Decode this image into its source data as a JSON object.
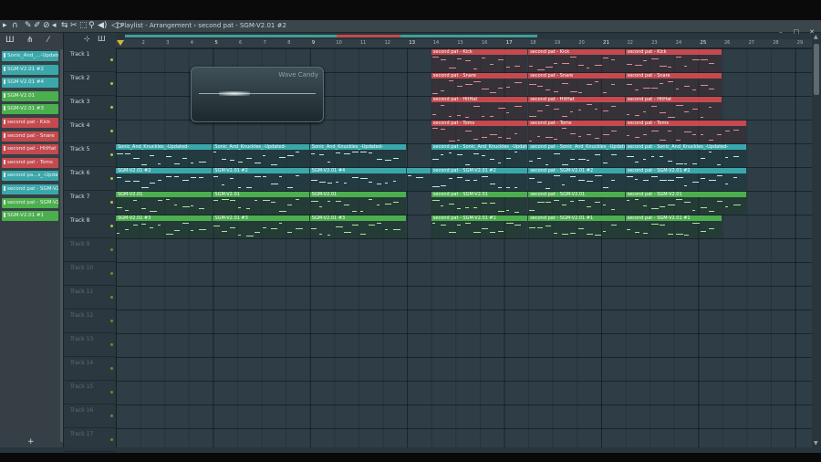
{
  "window": {
    "title": "Playlist - Arrangement › second pat - SGM-V2.01 #2",
    "buttons": [
      "–",
      "□",
      "✕"
    ]
  },
  "toolbar_icons": [
    "arrow-icon",
    "magnet-icon",
    "pencil-icon",
    "paint-icon",
    "delete-icon",
    "mute-icon",
    "slip-icon",
    "slice-icon",
    "select-icon",
    "zoom-icon",
    "speaker-icon"
  ],
  "sidebar": {
    "patterns": [
      {
        "label": "Sonic_And_...-Updated",
        "color": "#3aa8ab"
      },
      {
        "label": "SGM-V2.01 #2",
        "color": "#3aa8ab"
      },
      {
        "label": "SGM-V2.01 #4",
        "color": "#3aa8ab"
      },
      {
        "label": "SGM-V2.01",
        "color": "#4caf4e"
      },
      {
        "label": "SGM-V2.01 #3",
        "color": "#4caf4e"
      },
      {
        "label": "second pat - Kick",
        "color": "#c44a4f"
      },
      {
        "label": "second pat - Snare",
        "color": "#c44a4f"
      },
      {
        "label": "second pat - HitHat",
        "color": "#c44a4f"
      },
      {
        "label": "second pat - Toms",
        "color": "#c44a4f"
      },
      {
        "label": "second pa...s_-Updated",
        "color": "#3aa8ab"
      },
      {
        "label": "second pat - SGM-V2.01 #2",
        "color": "#3aa8ab"
      },
      {
        "label": "second pat - SGM-V2.01 #1",
        "color": "#4caf4e"
      },
      {
        "label": "SGM-V2.01 #1",
        "color": "#4caf4e"
      }
    ],
    "add_label": "+"
  },
  "tracks": [
    {
      "label": "Track 1",
      "dim": false
    },
    {
      "label": "Track 2",
      "dim": false
    },
    {
      "label": "Track 3",
      "dim": false
    },
    {
      "label": "Track 4",
      "dim": false
    },
    {
      "label": "Track 5",
      "dim": false
    },
    {
      "label": "Track 6",
      "dim": false
    },
    {
      "label": "Track 7",
      "dim": false
    },
    {
      "label": "Track 8",
      "dim": false
    },
    {
      "label": "Track 9",
      "dim": true
    },
    {
      "label": "Track 10",
      "dim": true
    },
    {
      "label": "Track 11",
      "dim": true
    },
    {
      "label": "Track 12",
      "dim": true
    },
    {
      "label": "Track 13",
      "dim": true
    },
    {
      "label": "Track 14",
      "dim": true
    },
    {
      "label": "Track 15",
      "dim": true
    },
    {
      "label": "Track 16",
      "dim": true
    },
    {
      "label": "Track 17",
      "dim": true
    }
  ],
  "ruler": {
    "bars": [
      2,
      3,
      4,
      5,
      6,
      7,
      8,
      9,
      10,
      11,
      12,
      13,
      14,
      15,
      16,
      17,
      18,
      19,
      20,
      21,
      22,
      23,
      24,
      25,
      26,
      27,
      28,
      29
    ],
    "emphasized": [
      5,
      9,
      13,
      17,
      21,
      25
    ]
  },
  "plugin": {
    "name": "Wave Candy"
  },
  "clips": [
    {
      "track": 1,
      "start": 14,
      "len": 4,
      "name": "second pat - Kick",
      "color": "red"
    },
    {
      "track": 1,
      "start": 18,
      "len": 4,
      "name": "second pat - Kick",
      "color": "red"
    },
    {
      "track": 1,
      "start": 22,
      "len": 4,
      "name": "second pat - Kick",
      "color": "red"
    },
    {
      "track": 2,
      "start": 14,
      "len": 4,
      "name": "second pat - Snare",
      "color": "red"
    },
    {
      "track": 2,
      "start": 18,
      "len": 4,
      "name": "second pat - Snare",
      "color": "red"
    },
    {
      "track": 2,
      "start": 22,
      "len": 4,
      "name": "second pat - Snare",
      "color": "red"
    },
    {
      "track": 3,
      "start": 14,
      "len": 4,
      "name": "second pat - HitHat",
      "color": "red"
    },
    {
      "track": 3,
      "start": 18,
      "len": 4,
      "name": "second pat - HitHat",
      "color": "red"
    },
    {
      "track": 3,
      "start": 22,
      "len": 4,
      "name": "second pat - HitHat",
      "color": "red"
    },
    {
      "track": 4,
      "start": 14,
      "len": 4,
      "name": "second pat - Toms",
      "color": "red"
    },
    {
      "track": 4,
      "start": 18,
      "len": 4,
      "name": "second pat - Toms",
      "color": "red"
    },
    {
      "track": 4,
      "start": 22,
      "len": 5,
      "name": "second pat - Toms",
      "color": "red"
    },
    {
      "track": 5,
      "start": 1,
      "len": 4,
      "name": "Sonic_And_Knuckles_-Updated-",
      "color": "teal"
    },
    {
      "track": 5,
      "start": 5,
      "len": 4,
      "name": "Sonic_And_Knuckles_-Updated-",
      "color": "teal"
    },
    {
      "track": 5,
      "start": 9,
      "len": 4,
      "name": "Sonic_And_Knuckles_-Updated-",
      "color": "teal"
    },
    {
      "track": 5,
      "start": 14,
      "len": 4,
      "name": "second pat - Sonic_And_Knuckles_-Updated-",
      "color": "teal"
    },
    {
      "track": 5,
      "start": 18,
      "len": 4,
      "name": "second pat - Sonic_And_Knuckles_-Updated-",
      "color": "teal"
    },
    {
      "track": 5,
      "start": 22,
      "len": 5,
      "name": "second pat - Sonic_And_Knuckles_-Updated-",
      "color": "teal"
    },
    {
      "track": 6,
      "start": 1,
      "len": 4,
      "name": "SGM-V2.01 #2",
      "color": "teal"
    },
    {
      "track": 6,
      "start": 5,
      "len": 4,
      "name": "SGM-V2.01 #2",
      "color": "teal"
    },
    {
      "track": 6,
      "start": 9,
      "len": 4,
      "name": "SGM-V2.01 #4",
      "color": "teal"
    },
    {
      "track": 6,
      "start": 13,
      "len": 1,
      "name": "",
      "color": "teal"
    },
    {
      "track": 6,
      "start": 14,
      "len": 4,
      "name": "second pat - SGM-V2.01 #2",
      "color": "teal"
    },
    {
      "track": 6,
      "start": 18,
      "len": 4,
      "name": "second pat - SGM-V2.01 #2",
      "color": "teal"
    },
    {
      "track": 6,
      "start": 22,
      "len": 5,
      "name": "second pat - SGM-V2.01 #2",
      "color": "teal"
    },
    {
      "track": 7,
      "start": 1,
      "len": 4,
      "name": "SGM-V2.01",
      "color": "green"
    },
    {
      "track": 7,
      "start": 5,
      "len": 4,
      "name": "SGM-V2.01",
      "color": "green"
    },
    {
      "track": 7,
      "start": 9,
      "len": 4,
      "name": "SGM-V2.01",
      "color": "green"
    },
    {
      "track": 7,
      "start": 14,
      "len": 4,
      "name": "second pat - SGM-V2.01",
      "color": "green"
    },
    {
      "track": 7,
      "start": 18,
      "len": 4,
      "name": "second pat - SGM-V2.01",
      "color": "green"
    },
    {
      "track": 7,
      "start": 22,
      "len": 5,
      "name": "second pat - SGM-V2.01",
      "color": "green"
    },
    {
      "track": 8,
      "start": 1,
      "len": 4,
      "name": "SGM-V2.01 #3",
      "color": "green"
    },
    {
      "track": 8,
      "start": 5,
      "len": 4,
      "name": "SGM-V2.01 #3",
      "color": "green"
    },
    {
      "track": 8,
      "start": 9,
      "len": 4,
      "name": "SGM-V2.01 #3",
      "color": "green"
    },
    {
      "track": 8,
      "start": 14,
      "len": 4,
      "name": "second pat - SGM-V2.01 #1",
      "color": "green"
    },
    {
      "track": 8,
      "start": 18,
      "len": 4,
      "name": "second pat - SGM-V2.01 #1",
      "color": "green"
    },
    {
      "track": 8,
      "start": 22,
      "len": 4,
      "name": "second pat - SGM-V2.01 #1",
      "color": "green"
    }
  ],
  "colors": {
    "red": "#c44a4f",
    "teal": "#3aa8ab",
    "green": "#4caf4e",
    "background": "#2f3e46"
  }
}
